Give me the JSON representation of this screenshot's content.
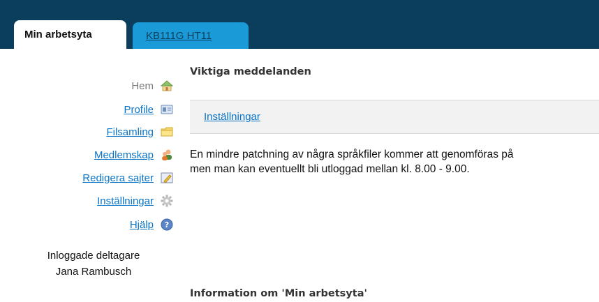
{
  "tabs": [
    {
      "label": "Min arbetsyta",
      "active": true
    },
    {
      "label": "KB111G HT11",
      "active": false
    }
  ],
  "sidebar": {
    "items": [
      {
        "label": "Hem",
        "icon": "home-icon",
        "link": false
      },
      {
        "label": "Profile",
        "icon": "profile-card-icon",
        "link": true
      },
      {
        "label": "Filsamling",
        "icon": "folder-icon",
        "link": true
      },
      {
        "label": "Medlemskap",
        "icon": "people-icon",
        "link": true
      },
      {
        "label": "Redigera sajter",
        "icon": "edit-site-icon",
        "link": true
      },
      {
        "label": "Inställningar",
        "icon": "gear-icon",
        "link": true
      },
      {
        "label": "Hjälp",
        "icon": "help-icon",
        "link": true
      }
    ],
    "online_heading": "Inloggade deltagare",
    "online_users": [
      "Jana Rambusch"
    ]
  },
  "main": {
    "messages_title": "Viktiga meddelanden",
    "settings_link": "Inställningar",
    "message_lines": [
      "En mindre patchning av några språkfiler kommer att genomföras på",
      "men man kan eventuellt bli utloggad mellan kl. 8.00 - 9.00."
    ],
    "info_title": "Information om 'Min arbetsyta'"
  },
  "colors": {
    "topbar": "#0b3e5c",
    "inactive_tab": "#1a9ad6",
    "link": "#0a74c7"
  }
}
